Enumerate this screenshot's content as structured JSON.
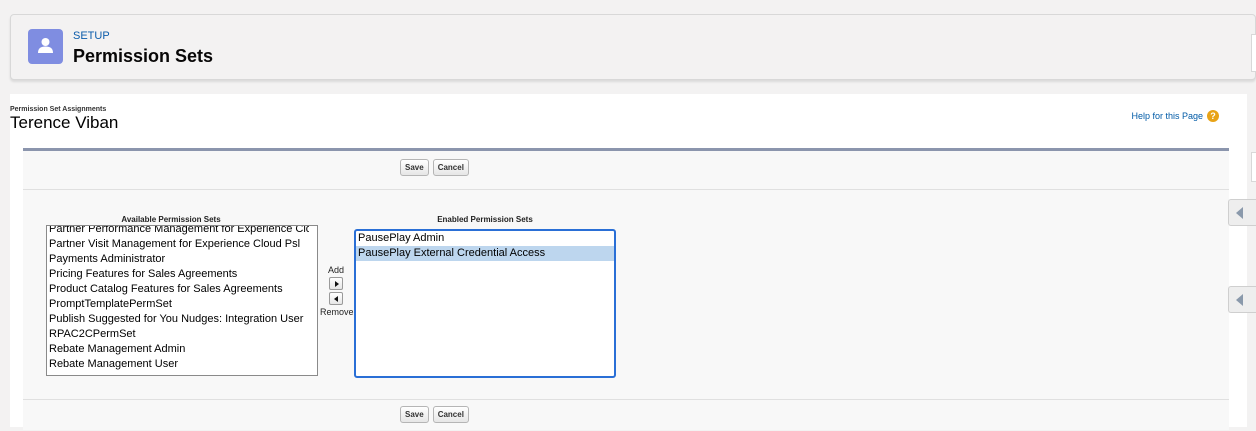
{
  "header": {
    "setup_label": "SETUP",
    "title": "Permission Sets",
    "icon": "user-icon",
    "icon_color": "#7f8de1"
  },
  "page": {
    "breadcrumb": "Permission Set Assignments",
    "user_name": "Terence Viban",
    "help_link": "Help for this Page",
    "help_icon": "question-mark-icon"
  },
  "buttons": {
    "save": "Save",
    "cancel": "Cancel"
  },
  "available": {
    "title": "Available Permission Sets",
    "items": [
      "Partner Performance Management for Experience Cloud",
      "Partner Visit Management for Experience Cloud Psl",
      "Payments Administrator",
      "Pricing Features for Sales Agreements",
      "Product Catalog Features for Sales Agreements",
      "PromptTemplatePermSet",
      "Publish Suggested for You Nudges: Integration User",
      "RPAC2CPermSet",
      "Rebate Management Admin",
      "Rebate Management User"
    ]
  },
  "enabled": {
    "title": "Enabled Permission Sets",
    "items": [
      "PausePlay Admin",
      "PausePlay External Credential Access"
    ],
    "selected_index": 1
  },
  "mover": {
    "add_label": "Add",
    "remove_label": "Remove"
  },
  "colors": {
    "accent": "#2a6fd6",
    "link": "#015ba7",
    "selection": "#bdd6ee"
  }
}
